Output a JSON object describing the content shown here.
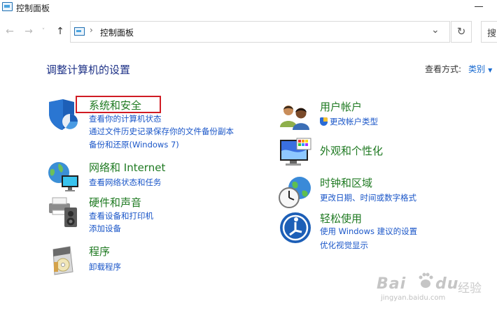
{
  "window": {
    "title": "控制面板"
  },
  "nav": {
    "back": "←",
    "forward": "→",
    "recent": "˅",
    "up": "↑",
    "breadcrumb_sep": "›",
    "breadcrumb": "控制面板",
    "dropdown": "⌄",
    "refresh": "↻",
    "search_label": "搜"
  },
  "page": {
    "heading": "调整计算机的设置",
    "view_by_label": "查看方式:",
    "view_by_value": "类别"
  },
  "left_categories": [
    {
      "title": "系统和安全",
      "icon": "shield-pie-icon",
      "links": [
        "查看你的计算机状态",
        "通过文件历史记录保存你的文件备份副本",
        "备份和还原(Windows 7)"
      ]
    },
    {
      "title": "网络和 Internet",
      "icon": "network-globe-icon",
      "links": [
        "查看网络状态和任务"
      ]
    },
    {
      "title": "硬件和声音",
      "icon": "printer-speaker-icon",
      "links": [
        "查看设备和打印机",
        "添加设备"
      ]
    },
    {
      "title": "程序",
      "icon": "programs-disc-icon",
      "links": [
        "卸载程序"
      ]
    }
  ],
  "right_categories": [
    {
      "title": "用户帐户",
      "icon": "users-icon",
      "links": [
        "更改帐户类型"
      ]
    },
    {
      "title": "外观和个性化",
      "icon": "monitor-palette-icon",
      "links": []
    },
    {
      "title": "时钟和区域",
      "icon": "clock-globe-icon",
      "links": [
        "更改日期、时间或数字格式"
      ]
    },
    {
      "title": "轻松使用",
      "icon": "ease-of-access-icon",
      "links": [
        "使用 Windows 建议的设置",
        "优化视觉显示"
      ]
    }
  ],
  "watermark": {
    "logo": "Bai",
    "logo2": "du",
    "text": "经验",
    "url": "jingyan.baidu.com"
  },
  "colors": {
    "category_title": "#1f7a22",
    "link": "#1a56c8",
    "heading": "#1e3287",
    "highlight_box": "#d01c24"
  }
}
